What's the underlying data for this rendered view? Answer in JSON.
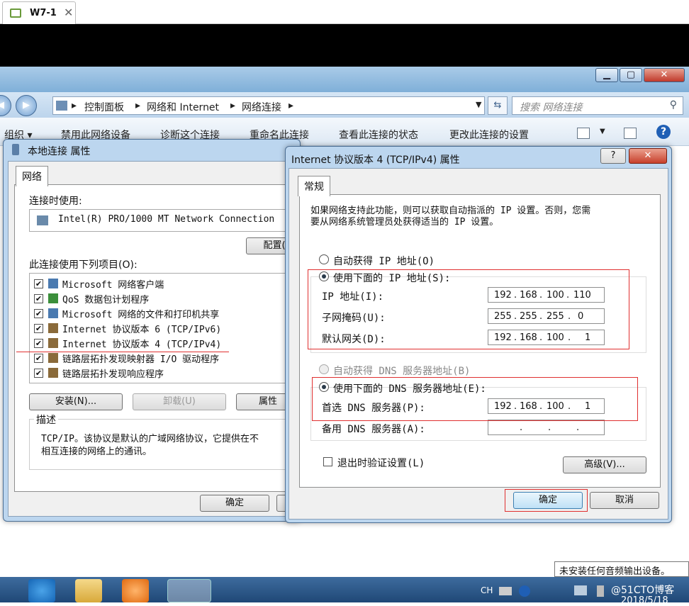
{
  "vm": {
    "tab_title": "W7-1",
    "tab_close": "✕"
  },
  "window_controls": {
    "min": "▁",
    "max": "▢",
    "close": "✕"
  },
  "address": {
    "crumbs": [
      "控制面板",
      "网络和 Internet",
      "网络连接"
    ],
    "search_placeholder": "搜索 网络连接"
  },
  "commands": [
    "组织 ▾",
    "禁用此网络设备",
    "诊断这个连接",
    "重命名此连接",
    "查看此连接的状态",
    "更改此连接的设置"
  ],
  "local_conn": {
    "title": "本地连接 属性",
    "tab": "网络",
    "connect_using_label": "连接时使用:",
    "adapter": "Intel(R) PRO/1000 MT Network Connection",
    "configure_btn": "配置(",
    "items_label": "此连接使用下列项目(O):",
    "items": [
      {
        "label": "Microsoft 网络客户端",
        "checked": true
      },
      {
        "label": "QoS 数据包计划程序",
        "checked": true
      },
      {
        "label": "Microsoft 网络的文件和打印机共享",
        "checked": true
      },
      {
        "label": "Internet 协议版本 6 (TCP/IPv6)",
        "checked": true
      },
      {
        "label": "Internet 协议版本 4 (TCP/IPv4)",
        "checked": true
      },
      {
        "label": "链路层拓扑发现映射器 I/O 驱动程序",
        "checked": true
      },
      {
        "label": "链路层拓扑发现响应程序",
        "checked": true
      }
    ],
    "install_btn": "安装(N)...",
    "uninstall_btn": "卸载(U)",
    "properties_btn": "属性",
    "desc_legend": "描述",
    "desc_line1": "TCP/IP。该协议是默认的广域网络协议，它提供在不",
    "desc_line2": "相互连接的网络上的通讯。",
    "ok_btn": "确定"
  },
  "ipv4": {
    "title": "Internet 协议版本 4 (TCP/IPv4) 属性",
    "help": "?",
    "close": "✕",
    "tab": "常规",
    "intro1": "如果网络支持此功能，则可以获取自动指派的 IP 设置。否则，您需",
    "intro2": "要从网络系统管理员处获得适当的 IP 设置。",
    "auto_ip": "自动获得 IP 地址(O)",
    "manual_ip": "使用下面的 IP 地址(S):",
    "ip_label": "IP 地址(I):",
    "ip": [
      "192",
      "168",
      "100",
      "110"
    ],
    "mask_label": "子网掩码(U):",
    "mask": [
      "255",
      "255",
      "255",
      "0"
    ],
    "gw_label": "默认网关(D):",
    "gw": [
      "192",
      "168",
      "100",
      "1"
    ],
    "auto_dns": "自动获得 DNS 服务器地址(B)",
    "manual_dns": "使用下面的 DNS 服务器地址(E):",
    "pdns_label": "首选 DNS 服务器(P):",
    "pdns": [
      "192",
      "168",
      "100",
      "1"
    ],
    "adns_label": "备用 DNS 服务器(A):",
    "validate": "退出时验证设置(L)",
    "advanced_btn": "高级(V)...",
    "ok_btn": "确定",
    "cancel_btn": "取消",
    "dot": "."
  },
  "taskbar": {
    "lang": "CH",
    "date": "2018/5/18",
    "watermark": "@51CTO博客"
  },
  "balloon": "未安装任何音频输出设备。"
}
